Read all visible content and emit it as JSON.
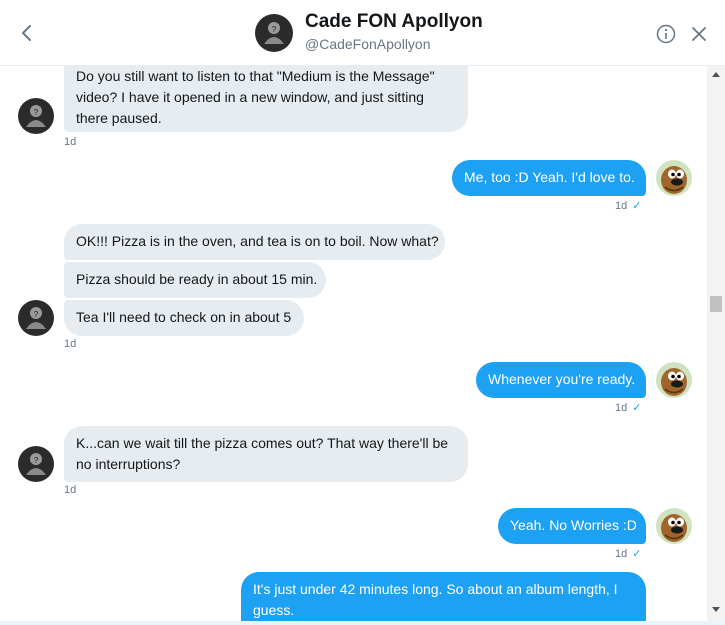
{
  "header": {
    "name": "Cade FON Apollyon",
    "handle": "@CadeFonApollyon"
  },
  "messages": [
    {
      "direction": "in",
      "lines": [
        "Do you still want to listen to that \"Medium is the Message\"",
        "video? I have it opened in a new window, and just sitting",
        "there paused."
      ],
      "time": "1d"
    },
    {
      "direction": "out",
      "lines": [
        "Me, too :D Yeah. I'd love to."
      ],
      "time": "1d"
    },
    {
      "direction": "in",
      "lines": [
        "OK!!! Pizza is in the oven, and tea is on to boil. Now what?"
      ]
    },
    {
      "direction": "in",
      "lines": [
        "Pizza should be ready in about 15 min."
      ]
    },
    {
      "direction": "in",
      "lines": [
        "Tea I'll need to check on in about 5"
      ],
      "time": "1d"
    },
    {
      "direction": "out",
      "lines": [
        "Whenever you're ready."
      ],
      "time": "1d"
    },
    {
      "direction": "in",
      "lines": [
        "K...can we wait till the pizza comes out? That way there'll be",
        "no interruptions?"
      ],
      "time": "1d"
    },
    {
      "direction": "out",
      "lines": [
        "Yeah. No Worries :D"
      ],
      "time": "1d"
    },
    {
      "direction": "out",
      "lines": [
        "It's just under 42 minutes long. So about an album length, I",
        "guess."
      ]
    }
  ],
  "colors": {
    "incoming_bubble": "#e6ecf0",
    "outgoing_bubble": "#1da1f2",
    "read_check": "#1da1f2"
  },
  "icons": {
    "back": "chevron-left-icon",
    "info": "info-icon",
    "close": "close-icon",
    "read_receipt": "check-icon"
  }
}
